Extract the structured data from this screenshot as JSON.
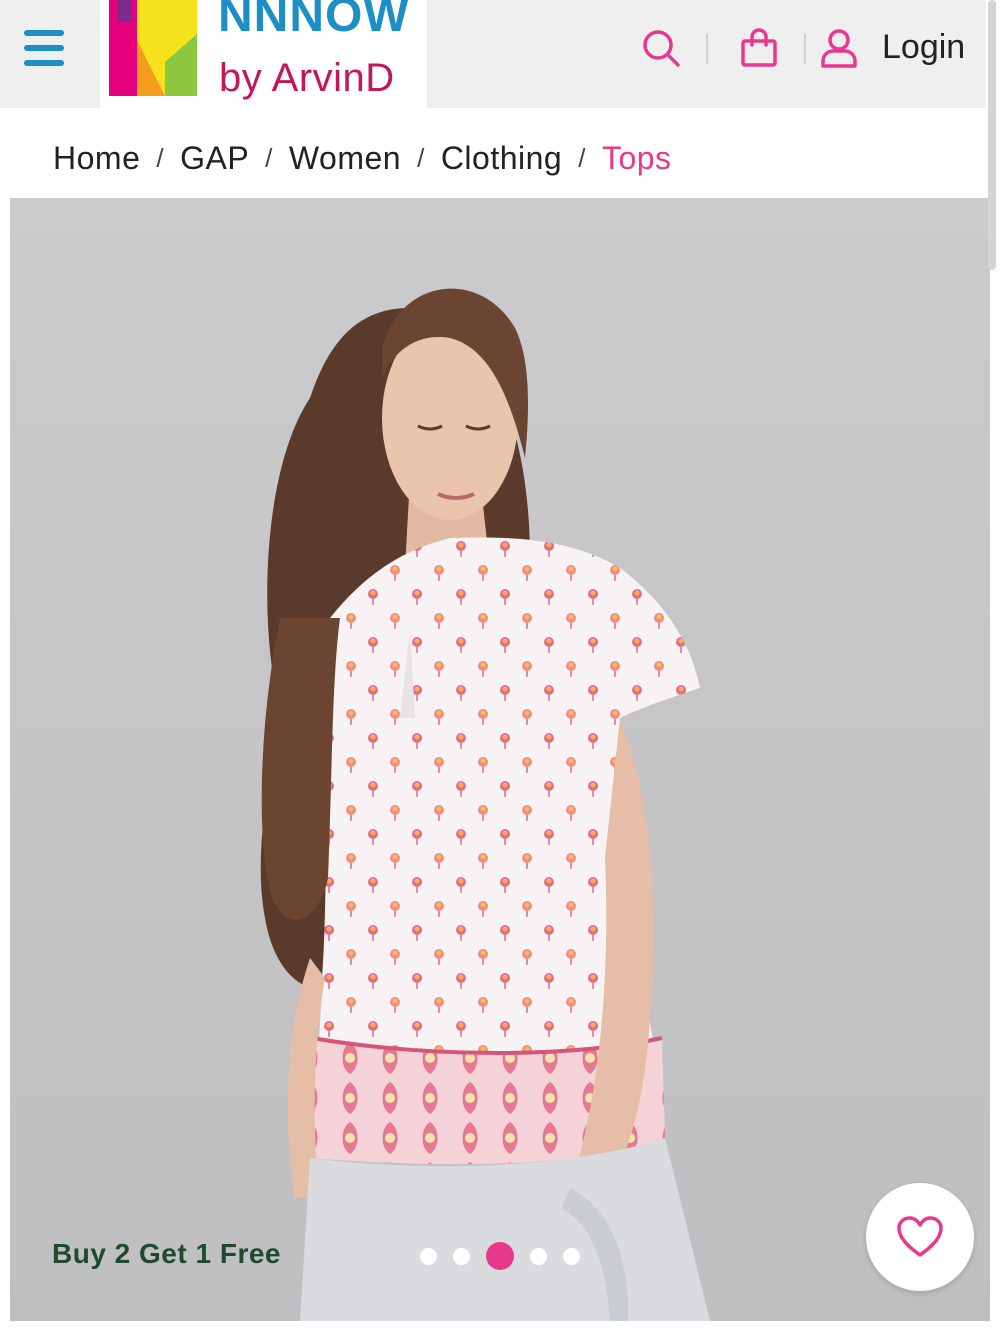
{
  "header": {
    "logo": {
      "brand_top": "NNNOW",
      "brand_bottom": "by ArvinD"
    },
    "login_label": "Login",
    "icons": [
      "menu-icon",
      "search-icon",
      "bag-icon",
      "user-icon"
    ],
    "accent_color": "#e8388e",
    "menu_color": "#1d8fc5"
  },
  "breadcrumb": {
    "items": [
      "Home",
      "GAP",
      "Women",
      "Clothing",
      "Tops"
    ],
    "separator": "/"
  },
  "product_gallery": {
    "offer_text": "Buy 2 Get 1 Free",
    "slide_count": 5,
    "active_slide": 3,
    "wishlist_icon": "heart-icon"
  }
}
